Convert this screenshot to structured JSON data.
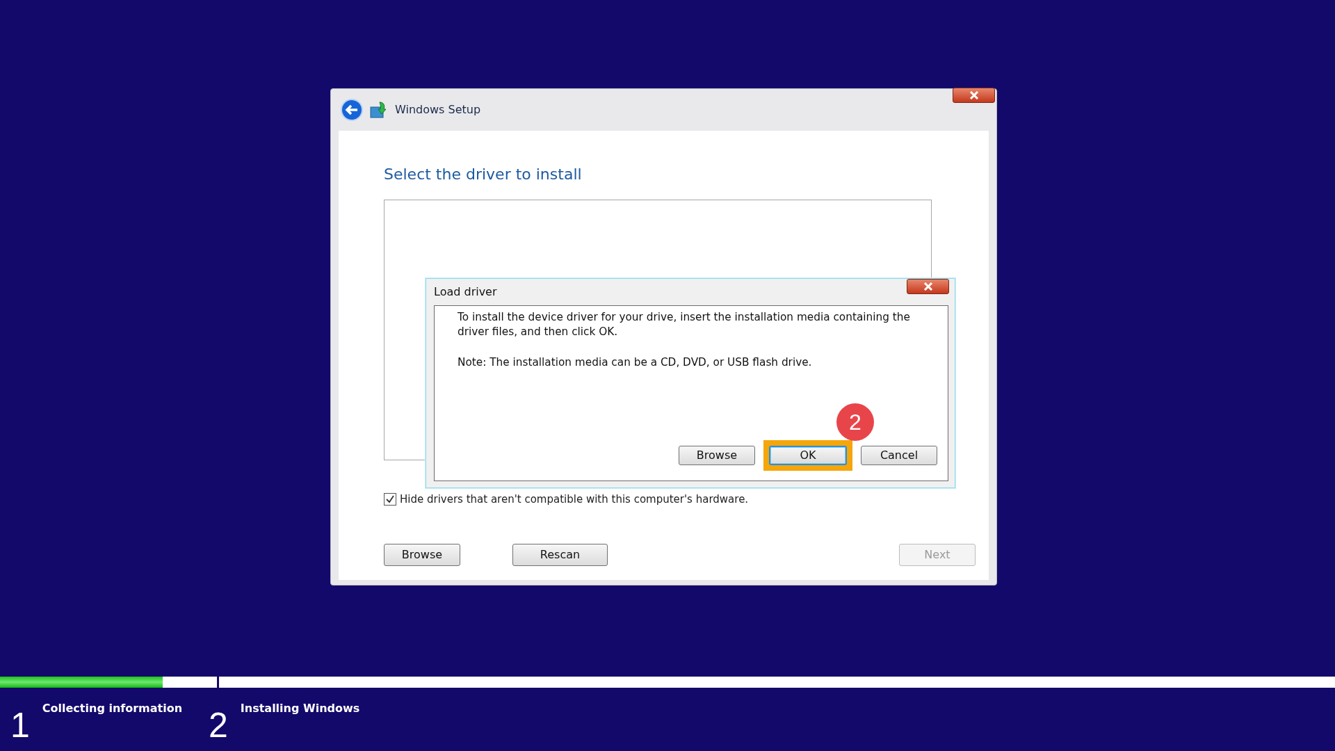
{
  "window": {
    "title": "Windows Setup",
    "heading": "Select the driver to install",
    "checkbox": {
      "label": "Hide drivers that aren't compatible with this computer's hardware.",
      "checked": true
    },
    "buttons": [
      {
        "label": "Browse",
        "disabled": false
      },
      {
        "label": "Rescan",
        "disabled": false
      },
      {
        "label": "Next",
        "disabled": true
      }
    ]
  },
  "dialog": {
    "title": "Load driver",
    "paragraphs": [
      "To install the device driver for your drive, insert the installation media containing the driver files, and then click OK.",
      "Note: The installation media can be a CD, DVD, or USB flash drive."
    ],
    "buttons": [
      {
        "label": "Browse",
        "default": false,
        "highlighted": false
      },
      {
        "label": "OK",
        "default": true,
        "highlighted": true
      },
      {
        "label": "Cancel",
        "default": false,
        "highlighted": false
      }
    ],
    "step_badge": "2"
  },
  "progress": [
    {
      "number": "1",
      "label": "Collecting information",
      "level": 0.75
    },
    {
      "number": "2",
      "label": "Installing Windows",
      "level": 0
    }
  ]
}
